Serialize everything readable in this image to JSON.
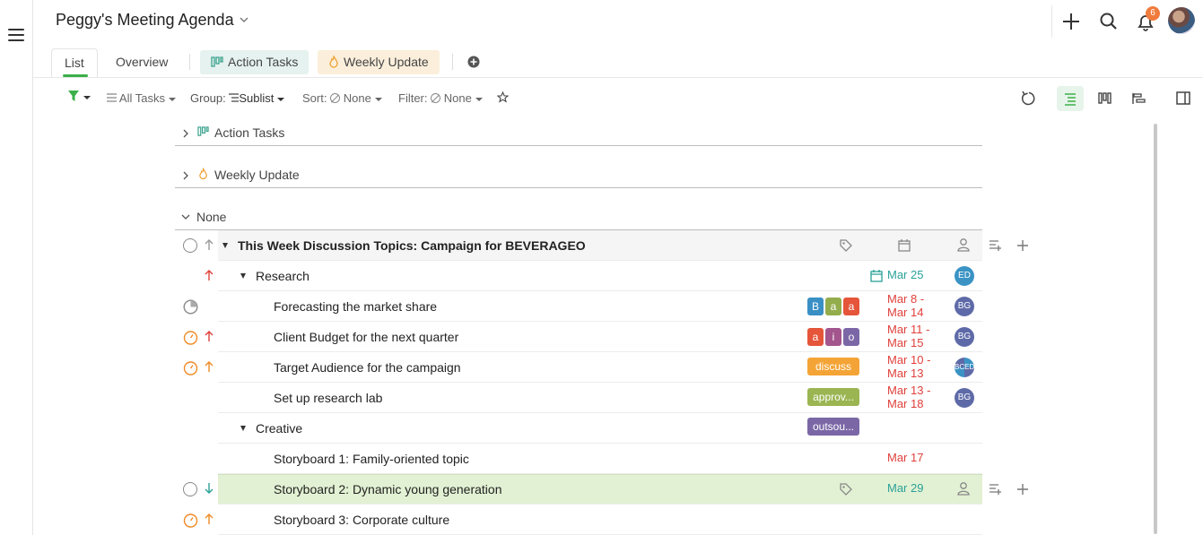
{
  "header": {
    "title": "Peggy's Meeting Agenda",
    "notification_count": "6"
  },
  "tabs": {
    "list": "List",
    "overview": "Overview",
    "action_tasks": "Action Tasks",
    "weekly_update": "Weekly Update"
  },
  "toolbar": {
    "all_tasks": "All Tasks",
    "group_key": "Group:",
    "group_val": "Sublist",
    "sort_key": "Sort:",
    "sort_val": "None",
    "filter_key": "Filter:",
    "filter_val": "None"
  },
  "groups": {
    "action_tasks": "Action Tasks",
    "weekly_update": "Weekly Update",
    "none": "None"
  },
  "rows": {
    "parent": {
      "title": "This Week Discussion Topics: Campaign for BEVERAGEO"
    },
    "research": {
      "title": "Research",
      "date": "Mar 25",
      "avatar": "ED"
    },
    "forecast": {
      "title": "Forecasting the market share",
      "tags": [
        "B",
        "a",
        "a"
      ],
      "date1": "Mar 8 -",
      "date2": "Mar 14",
      "avatar": "BG"
    },
    "budget": {
      "title": "Client Budget for the next quarter",
      "tags": [
        "a",
        "i",
        "o"
      ],
      "date1": "Mar 11 -",
      "date2": "Mar 15",
      "avatar": "BG"
    },
    "audience": {
      "title": "Target Audience for the campaign",
      "tag": "discuss",
      "date1": "Mar 10 -",
      "date2": "Mar 13",
      "avatar": "BCED"
    },
    "lab": {
      "title": "Set up research lab",
      "tag": "approv...",
      "date1": "Mar 13 -",
      "date2": "Mar 18",
      "avatar": "BG"
    },
    "creative": {
      "title": "Creative",
      "tag": "outsou..."
    },
    "story1": {
      "title": "Storyboard 1: Family-oriented topic",
      "date": "Mar 17"
    },
    "story2": {
      "title": "Storyboard 2: Dynamic young generation",
      "date": "Mar 29"
    },
    "story3": {
      "title": "Storyboard 3: Corporate culture"
    }
  },
  "colors": {
    "accent_green": "#3bb04a",
    "date_red": "#e0403b",
    "date_teal": "#2aa198",
    "highlight_row": "#e2f1d3",
    "tag_blue": "#3a8fc4",
    "tag_olive": "#93ad4d",
    "tag_red": "#e5553a",
    "tag_purple": "#7b67a6",
    "tag_orange": "#f4a436",
    "tag_green": "#9ab552"
  },
  "icons": [
    "menu-icon",
    "chevron-down-icon",
    "plus-icon",
    "search-icon",
    "bell-icon",
    "filter-icon",
    "list-icon",
    "star-icon",
    "refresh-icon",
    "board-icon",
    "gantt-icon",
    "panel-icon",
    "tag-icon",
    "calendar-icon",
    "user-icon",
    "subtask-icon",
    "arrow-up-icon",
    "arrow-down-icon",
    "progress-icon",
    "expand-icon",
    "collapse-icon"
  ]
}
